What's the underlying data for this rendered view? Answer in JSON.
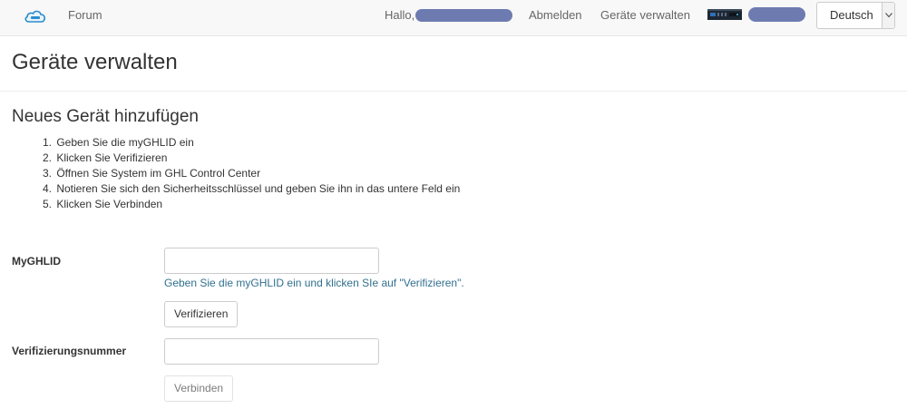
{
  "navbar": {
    "logo_icon": "cloud-logo-icon",
    "forum_label": "Forum",
    "hello_label": "Hallo,",
    "logout_label": "Abmelden",
    "devices_label": "Geräte verwalten",
    "device_icon": "device-thumbnail-icon",
    "language": {
      "selected": "Deutsch",
      "caret_icon": "chevron-down-icon"
    },
    "redaction_color": "#6d7bb1"
  },
  "page": {
    "title": "Geräte verwalten"
  },
  "add_device": {
    "title": "Neues Gerät hinzufügen",
    "steps": [
      {
        "num": "1.",
        "text": "Geben Sie die myGHLID ein"
      },
      {
        "num": "2.",
        "text": "Klicken Sie Verifizieren"
      },
      {
        "num": "3.",
        "text": "Öffnen Sie System im GHL Control Center"
      },
      {
        "num": "4.",
        "text": "Notieren Sie sich den Sicherheitsschlüssel und geben Sie ihn in das untere Feld ein"
      },
      {
        "num": "5.",
        "text": "Klicken Sie Verbinden"
      }
    ]
  },
  "form": {
    "myghlid_label": "MyGHLID",
    "myghlid_value": "",
    "myghlid_help": "Geben Sie die myGHLID ein und klicken SIe auf \"Verifizieren\".",
    "verify_button": "Verifizieren",
    "verif_label": "Verifizierungsnummer",
    "verif_value": "",
    "connect_button": "Verbinden",
    "help_color": "#31708f"
  }
}
